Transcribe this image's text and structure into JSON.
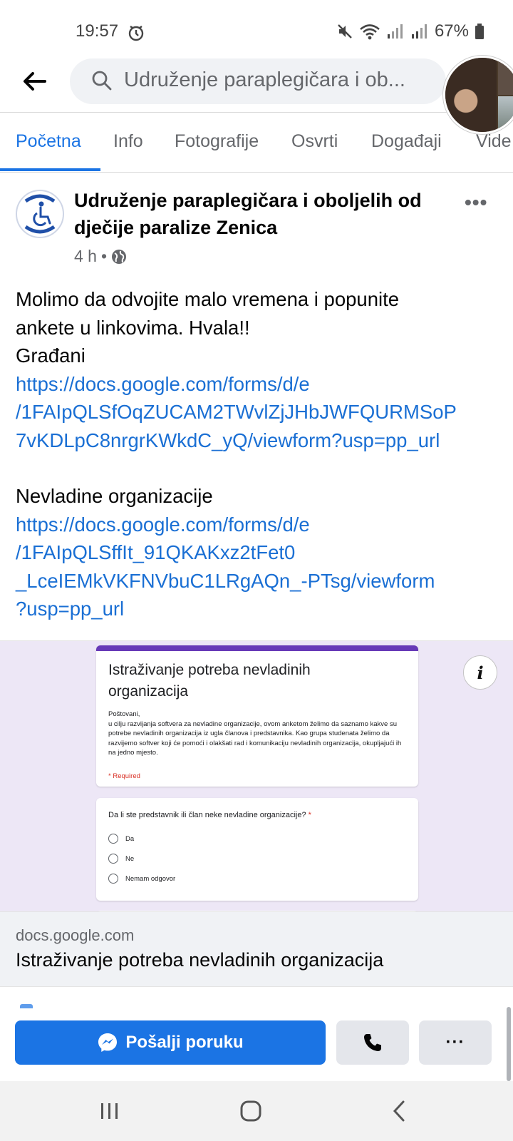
{
  "status_bar": {
    "time": "19:57",
    "battery": "67%"
  },
  "header": {
    "search_text": "Udruženje paraplegičara i ob..."
  },
  "tabs": [
    "Početna",
    "Info",
    "Fotografije",
    "Osvrti",
    "Događaji",
    "Vide"
  ],
  "post": {
    "author": "Udruženje paraplegičara i oboljelih od dječije paralize Zenica",
    "time": "4 h",
    "separator": "•",
    "body": {
      "line1": "Molimo da odvojite malo vremena i popunite",
      "line2": "ankete u linkovima. Hvala!!",
      "label1": "Građani",
      "link1": [
        "https://docs.google.com/forms/d/e",
        "/1FAIpQLSfOqZUCAM2TWvlZjJHbJWFQURMSoP",
        "7vKDLpC8nrgrKWkdC_yQ/viewform?usp=pp_url"
      ],
      "label2": "Nevladine organizacije",
      "link2": [
        "https://docs.google.com/forms/d/e",
        "/1FAIpQLSffIt_91QKAKxz2tFet0",
        "_LceIEMkVKFNVbuC1LRgAQn_-PTsg/viewform",
        "?usp=pp_url"
      ]
    }
  },
  "preview": {
    "form_title": "Istraživanje potreba nevladinih organizacija",
    "form_greeting": "Poštovani,",
    "form_description": "u cilju razvijanja softvera za nevladine organizacije, ovom anketom želimo da saznamo kakve su potrebe nevladinih organizacija iz ugla članova i predstavnika. Kao grupa studenata želimo da razvijemo softver koji će pomoći i olakšati rad i komunikaciju nevladinih organizacija, okupljajući ih na jedno mjesto.",
    "required_note": "* Required",
    "question": "Da li ste predstavnik ili član neke nevladine organizacije?",
    "question_star": "*",
    "options": [
      "Da",
      "Ne",
      "Nemam odgovor"
    ],
    "info_glyph": "i"
  },
  "link_caption": {
    "domain": "docs.google.com",
    "title": "Istraživanje potreba nevladinih organizacija"
  },
  "actions": {
    "message_label": "Pošalji poruku",
    "more_label": "···"
  },
  "icons": {
    "back": "back-arrow-icon",
    "search": "search-icon",
    "globe": "globe-icon",
    "messenger": "messenger-icon",
    "phone": "phone-icon"
  },
  "colors": {
    "accent": "#1b74e4",
    "link": "#1a6fd4",
    "form_purple": "#673ab7"
  }
}
